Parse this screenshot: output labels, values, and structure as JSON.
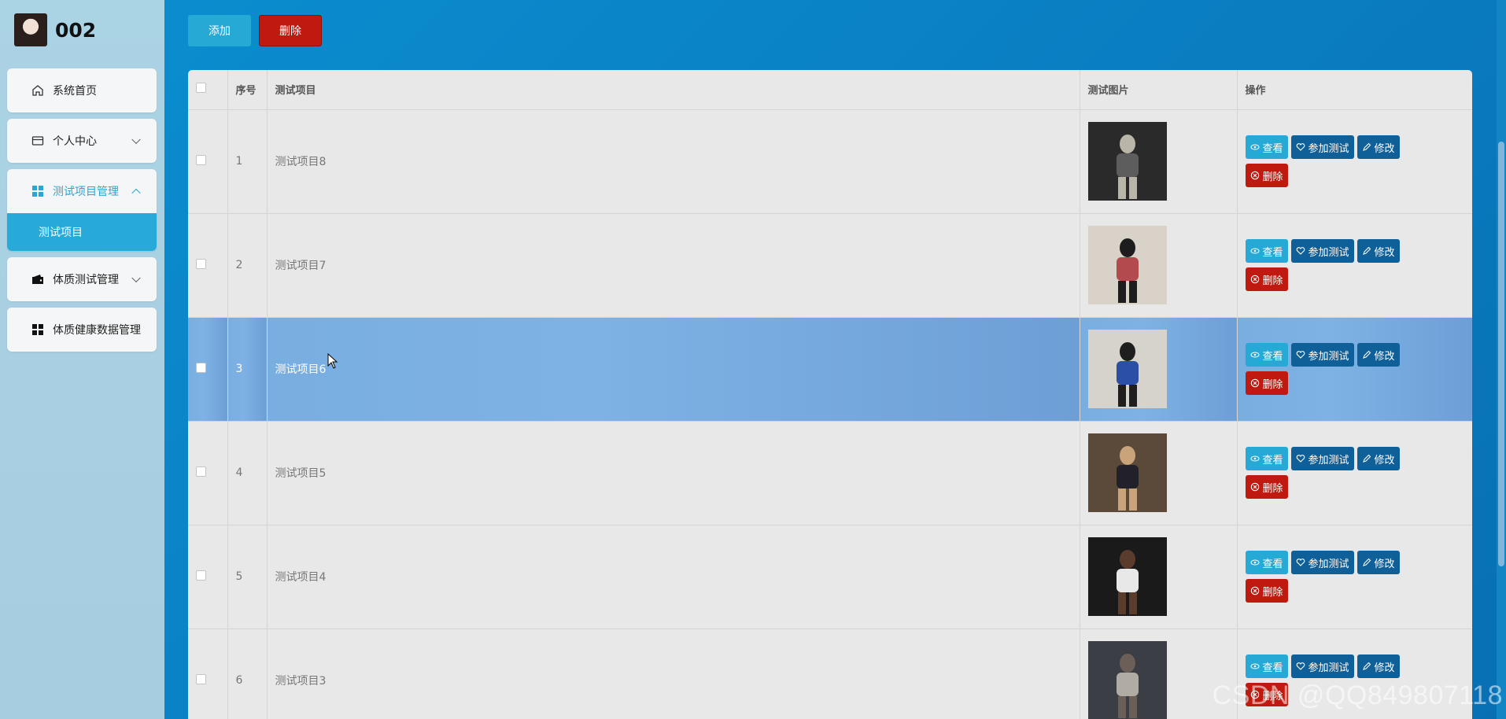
{
  "brand": {
    "name": "002"
  },
  "sidebar": {
    "items": [
      {
        "label": "系统首页",
        "icon": "home-icon"
      },
      {
        "label": "个人中心",
        "icon": "card-icon"
      },
      {
        "label": "测试项目管理",
        "icon": "grid-icon",
        "expanded": true,
        "children": [
          {
            "label": "测试项目"
          }
        ]
      },
      {
        "label": "体质测试管理",
        "icon": "wallet-icon"
      },
      {
        "label": "体质健康数据管理",
        "icon": "grid-icon"
      }
    ]
  },
  "toolbar": {
    "add_label": "添加",
    "delete_label": "删除"
  },
  "table": {
    "headers": {
      "index": "序号",
      "name": "测试项目",
      "image": "测试图片",
      "ops": "操作"
    },
    "rows": [
      {
        "index": "1",
        "name": "测试项目8"
      },
      {
        "index": "2",
        "name": "测试项目7"
      },
      {
        "index": "3",
        "name": "测试项目6"
      },
      {
        "index": "4",
        "name": "测试项目5"
      },
      {
        "index": "5",
        "name": "测试项目4"
      },
      {
        "index": "6",
        "name": "测试项目3"
      }
    ],
    "highlight_row": 3
  },
  "row_actions": {
    "view": "查看",
    "join": "参加测试",
    "edit": "修改",
    "delete": "删除"
  },
  "watermark": "CSDN @QQ849807118",
  "colors": {
    "accent": "#27a9d6",
    "danger": "#c0190f",
    "dark_action": "#0f5f98",
    "highlight": "#7eb2e4"
  }
}
